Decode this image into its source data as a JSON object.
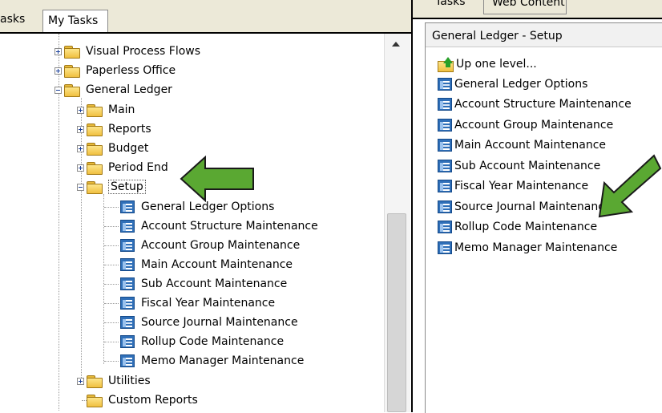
{
  "left_tabs": {
    "partial_label": "asks",
    "my_tasks_label": "My Tasks"
  },
  "tree": {
    "top_folders": [
      "Visual Process Flows",
      "Paperless Office",
      "General Ledger"
    ],
    "gl_children": [
      "Main",
      "Reports",
      "Budget",
      "Period End",
      "Setup"
    ],
    "setup_items": [
      "General Ledger Options",
      "Account Structure Maintenance",
      "Account Group Maintenance",
      "Main Account Maintenance",
      "Sub Account Maintenance",
      "Fiscal Year Maintenance",
      "Source Journal Maintenance",
      "Rollup Code Maintenance",
      "Memo Manager Maintenance"
    ],
    "after_setup": [
      "Utilities",
      "Custom Reports"
    ]
  },
  "right_tabs": {
    "tab1_label": "Tasks",
    "tab2_label": "Web Content"
  },
  "right_panel": {
    "header": "General Ledger - Setup",
    "up_label": "Up one level...",
    "items": [
      "General Ledger Options",
      "Account Structure Maintenance",
      "Account Group Maintenance",
      "Main Account Maintenance",
      "Sub Account Maintenance",
      "Fiscal Year Maintenance",
      "Source Journal Maintenance",
      "Rollup Code Maintenance",
      "Memo Manager Maintenance"
    ]
  },
  "colors": {
    "annotation_arrow": "#5aa832",
    "folder": "#f0c040",
    "doc_icon": "#2f6fb8"
  },
  "icons": [
    "folder-icon",
    "task-document-icon",
    "up-one-level-icon",
    "expand-plus-icon",
    "collapse-minus-icon"
  ]
}
